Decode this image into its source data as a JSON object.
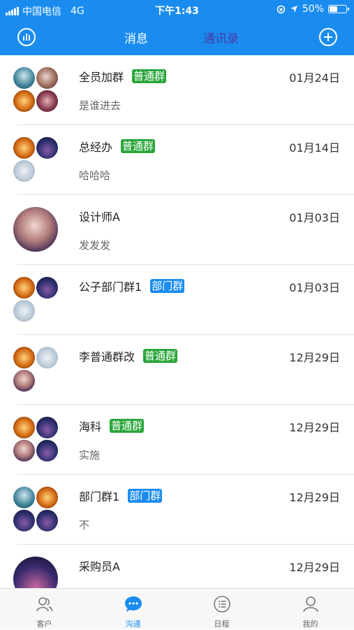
{
  "status_bar": {
    "carrier": "中国电信",
    "network": "4G",
    "time": "下午1:43",
    "battery": "50%"
  },
  "header": {
    "tabs": [
      "消息",
      "通讯录"
    ],
    "left_icon": "stats-icon",
    "right_icon": "add-circle-icon"
  },
  "conversations": [
    {
      "name": "全员加群",
      "tag": "普通群",
      "tag_color": "#2aa63a",
      "date": "01月24日",
      "preview": "是谁进去"
    },
    {
      "name": "总经办",
      "tag": "普通群",
      "tag_color": "#2aa63a",
      "date": "01月14日",
      "preview": "哈哈哈"
    },
    {
      "name": "设计师A",
      "tag": "",
      "tag_color": "",
      "date": "01月03日",
      "preview": "发发发"
    },
    {
      "name": "公子部门群1",
      "tag": "部门群",
      "tag_color": "#1a8cf0",
      "date": "01月03日",
      "preview": ""
    },
    {
      "name": "李普通群改",
      "tag": "普通群",
      "tag_color": "#2aa63a",
      "date": "12月29日",
      "preview": ""
    },
    {
      "name": "海科",
      "tag": "普通群",
      "tag_color": "#2aa63a",
      "date": "12月29日",
      "preview": "实施"
    },
    {
      "name": "部门群1",
      "tag": "部门群",
      "tag_color": "#1a8cf0",
      "date": "12月29日",
      "preview": "不"
    },
    {
      "name": "采购员A",
      "tag": "",
      "tag_color": "",
      "date": "12月29日",
      "preview": ""
    }
  ],
  "tabbar": [
    {
      "label": "客户",
      "icon": "customers-icon"
    },
    {
      "label": "沟通",
      "icon": "chat-icon",
      "active": true
    },
    {
      "label": "日程",
      "icon": "schedule-icon"
    },
    {
      "label": "我的",
      "icon": "profile-icon"
    }
  ],
  "colors": {
    "header": "#1a8cf0",
    "group_tag": "#2aa63a",
    "dept_tag": "#1a8cf0"
  }
}
